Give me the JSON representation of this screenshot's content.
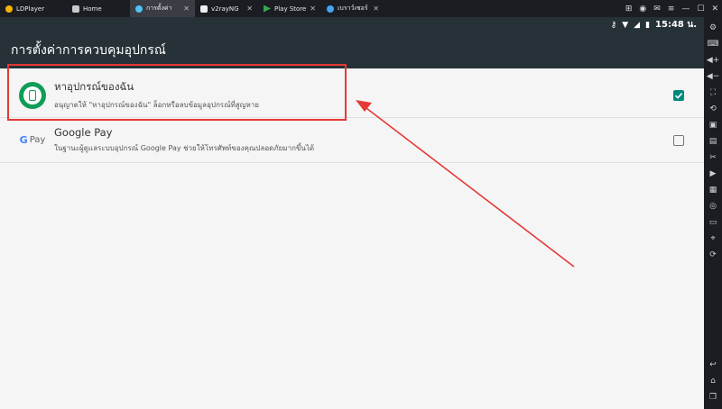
{
  "tabs": [
    {
      "label": "LDPlayer"
    },
    {
      "label": "Home"
    },
    {
      "label": "การตั้งค่า"
    },
    {
      "label": "v2rayNG"
    },
    {
      "label": "Play Store"
    },
    {
      "label": "เบราว์เซอร์"
    }
  ],
  "statusbar": {
    "time": "15:48 น."
  },
  "toolbar": {
    "title": "การตั้งค่าการควบคุมอุปกรณ์"
  },
  "rows": [
    {
      "title": "หาอุปกรณ์ของฉัน",
      "subtitle": "อนุญาตให้ \"หาอุปกรณ์ของฉัน\" ล็อกหรือลบข้อมูลอุปกรณ์ที่สูญหาย",
      "checked": true
    },
    {
      "title": "Google Pay",
      "subtitle": "ในฐานะผู้ดูแลระบบอุปกรณ์ Google Pay ช่วยให้โทรศัพท์ของคุณปลอดภัยมากขึ้นได้",
      "checked": false,
      "icon_label": "Pay"
    }
  ],
  "colors": {
    "accent": "#00897b",
    "toolbar": "#263238",
    "highlight": "#e53935",
    "fmd": "#0f9d58"
  }
}
